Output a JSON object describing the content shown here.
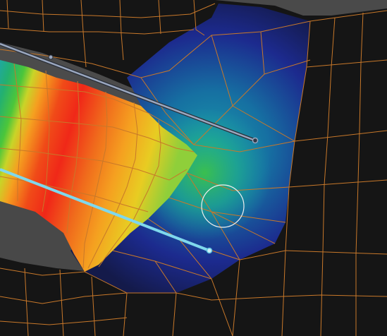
{
  "viewport": {
    "background": "#151515",
    "mesh_color": "#c8782a",
    "gray_body": "#4a4a4a"
  },
  "heatmap": {
    "palette": [
      "#1a1a7a",
      "#1f3aa0",
      "#1a9aa8",
      "#23b070",
      "#4cc63a",
      "#e0d020",
      "#f59020",
      "#f02818"
    ]
  },
  "tools": {
    "upper_handle": {
      "color": "#9aa7bf",
      "end_color": "#303846"
    },
    "lower_handle": {
      "color": "#7fd8ec",
      "end_color": "#cfeff7"
    },
    "brush_cursor": {
      "color": "#f0f0f0"
    }
  }
}
